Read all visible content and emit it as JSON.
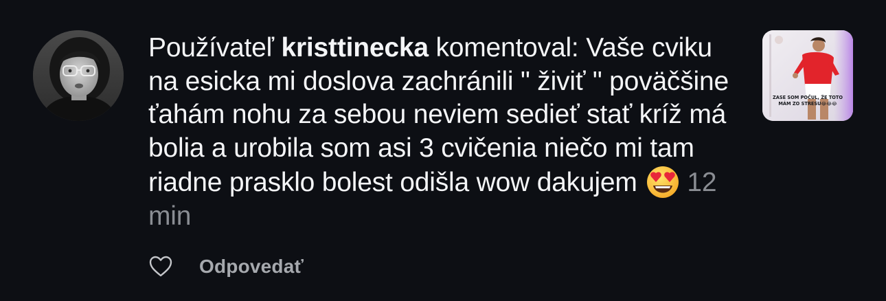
{
  "notification": {
    "prefix": "Používateľ ",
    "username": "kristtinecka",
    "verb": " komentoval: ",
    "comment": "Vaše cviku na esicka mi doslova zachránili \" živiť \" poväčšine ťahám nohu za sebou neviem sedieť stať kríž má bolia a urobila som asi 3 cvičenia niečo mi tam riadne prasklo bolest odišla wow dakujem ",
    "emoji": "smiling-face-with-heart-eyes",
    "time": "12 min"
  },
  "avatar": {
    "icon": "user-profile-photo",
    "style": "grayscale"
  },
  "post_thumbnail": {
    "caption_line1": "ZASE SOM POČUL, ŽE TOTO",
    "caption_line2": "MÁM ZO STRESU😂😂😂"
  },
  "actions": {
    "like_icon": "heart-outline-icon",
    "reply_label": "Odpovedať"
  },
  "colors": {
    "background": "#0d0f14",
    "text": "#f4f5f7",
    "muted": "#8a8d93",
    "action": "#a6a9ae"
  }
}
